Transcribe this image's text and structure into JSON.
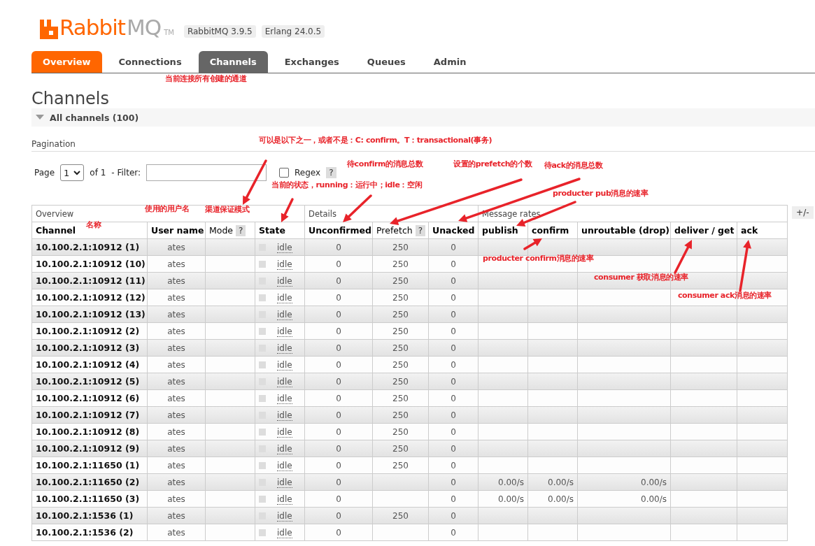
{
  "header": {
    "logo": {
      "name": "Rabbit",
      "suffix": "MQ",
      "trademark": "TM"
    },
    "versions": [
      "RabbitMQ 3.9.5",
      "Erlang 24.0.5"
    ]
  },
  "tabs": [
    {
      "label": "Overview",
      "kind": "home",
      "selected": false
    },
    {
      "label": "Connections",
      "kind": "normal",
      "selected": false
    },
    {
      "label": "Channels",
      "kind": "normal",
      "selected": true
    },
    {
      "label": "Exchanges",
      "kind": "normal",
      "selected": false
    },
    {
      "label": "Queues",
      "kind": "normal",
      "selected": false
    },
    {
      "label": "Admin",
      "kind": "normal",
      "selected": false
    }
  ],
  "page_title": "Channels",
  "section": {
    "title": "All channels (100)",
    "expanded": true
  },
  "pagination": {
    "heading": "Pagination",
    "page_label": "Page",
    "page": "1",
    "of": "of 1",
    "filter_label": "- Filter:",
    "regex": {
      "label": "Regex",
      "checked": false,
      "help": "?"
    }
  },
  "table": {
    "column_toggle": "+/-",
    "groups": [
      {
        "label": "Overview",
        "columns": [
          {
            "label": "Channel"
          },
          {
            "label": "User name"
          },
          {
            "label": "Mode",
            "help": "?"
          },
          {
            "label": "State"
          }
        ]
      },
      {
        "label": "Details",
        "columns": [
          {
            "label": "Unconfirmed"
          },
          {
            "label": "Prefetch",
            "help": "?"
          },
          {
            "label": "Unacked"
          }
        ]
      },
      {
        "label": "Message rates",
        "columns": [
          {
            "label": "publish"
          },
          {
            "label": "confirm"
          },
          {
            "label": "unroutable (drop)"
          },
          {
            "label": "deliver / get"
          },
          {
            "label": "ack"
          }
        ]
      }
    ],
    "rows": [
      {
        "channel": "10.100.2.1:10912 (1)",
        "user_name": "ates",
        "state": "idle",
        "unconfirmed": "0",
        "prefetch": "250",
        "unacked": "0"
      },
      {
        "channel": "10.100.2.1:10912 (10)",
        "user_name": "ates",
        "state": "idle",
        "unconfirmed": "0",
        "prefetch": "250",
        "unacked": "0"
      },
      {
        "channel": "10.100.2.1:10912 (11)",
        "user_name": "ates",
        "state": "idle",
        "unconfirmed": "0",
        "prefetch": "250",
        "unacked": "0"
      },
      {
        "channel": "10.100.2.1:10912 (12)",
        "user_name": "ates",
        "state": "idle",
        "unconfirmed": "0",
        "prefetch": "250",
        "unacked": "0"
      },
      {
        "channel": "10.100.2.1:10912 (13)",
        "user_name": "ates",
        "state": "idle",
        "unconfirmed": "0",
        "prefetch": "250",
        "unacked": "0"
      },
      {
        "channel": "10.100.2.1:10912 (2)",
        "user_name": "ates",
        "state": "idle",
        "unconfirmed": "0",
        "prefetch": "250",
        "unacked": "0"
      },
      {
        "channel": "10.100.2.1:10912 (3)",
        "user_name": "ates",
        "state": "idle",
        "unconfirmed": "0",
        "prefetch": "250",
        "unacked": "0"
      },
      {
        "channel": "10.100.2.1:10912 (4)",
        "user_name": "ates",
        "state": "idle",
        "unconfirmed": "0",
        "prefetch": "250",
        "unacked": "0"
      },
      {
        "channel": "10.100.2.1:10912 (5)",
        "user_name": "ates",
        "state": "idle",
        "unconfirmed": "0",
        "prefetch": "250",
        "unacked": "0"
      },
      {
        "channel": "10.100.2.1:10912 (6)",
        "user_name": "ates",
        "state": "idle",
        "unconfirmed": "0",
        "prefetch": "250",
        "unacked": "0"
      },
      {
        "channel": "10.100.2.1:10912 (7)",
        "user_name": "ates",
        "state": "idle",
        "unconfirmed": "0",
        "prefetch": "250",
        "unacked": "0"
      },
      {
        "channel": "10.100.2.1:10912 (8)",
        "user_name": "ates",
        "state": "idle",
        "unconfirmed": "0",
        "prefetch": "250",
        "unacked": "0"
      },
      {
        "channel": "10.100.2.1:10912 (9)",
        "user_name": "ates",
        "state": "idle",
        "unconfirmed": "0",
        "prefetch": "250",
        "unacked": "0"
      },
      {
        "channel": "10.100.2.1:11650 (1)",
        "user_name": "ates",
        "state": "idle",
        "unconfirmed": "0",
        "prefetch": "250",
        "unacked": "0"
      },
      {
        "channel": "10.100.2.1:11650 (2)",
        "user_name": "ates",
        "state": "idle",
        "unconfirmed": "0",
        "unacked": "0",
        "publish": "0.00/s",
        "confirm": "0.00/s",
        "unroutable": "0.00/s"
      },
      {
        "channel": "10.100.2.1:11650 (3)",
        "user_name": "ates",
        "state": "idle",
        "unconfirmed": "0",
        "unacked": "0",
        "publish": "0.00/s",
        "confirm": "0.00/s",
        "unroutable": "0.00/s"
      },
      {
        "channel": "10.100.2.1:1536 (1)",
        "user_name": "ates",
        "state": "idle",
        "unconfirmed": "0",
        "prefetch": "250",
        "unacked": "0"
      },
      {
        "channel": "10.100.2.1:1536 (2)",
        "user_name": "ates",
        "state": "idle",
        "unconfirmed": "0",
        "unacked": "0"
      }
    ]
  },
  "annotations": [
    {
      "text": "当前连接所有创建的通道"
    },
    {
      "text": "可以是以下之一，或者不是：C: confirm。T：transactional(事务)"
    },
    {
      "text": "待confirm的消息总数"
    },
    {
      "text": "设置的prefetch的个数"
    },
    {
      "text": "待ack的消息总数"
    },
    {
      "text": "当前的状态，running：运行中；idle：空闲"
    },
    {
      "text": "producter pub消息的速率"
    },
    {
      "text": "使用的用户名"
    },
    {
      "text": "渠道保证模式"
    },
    {
      "text": "名称"
    },
    {
      "text": "producter confirm消息的速率"
    },
    {
      "text": "consumer 获取消息的速率"
    },
    {
      "text": "consumer ack消息的速率"
    }
  ]
}
